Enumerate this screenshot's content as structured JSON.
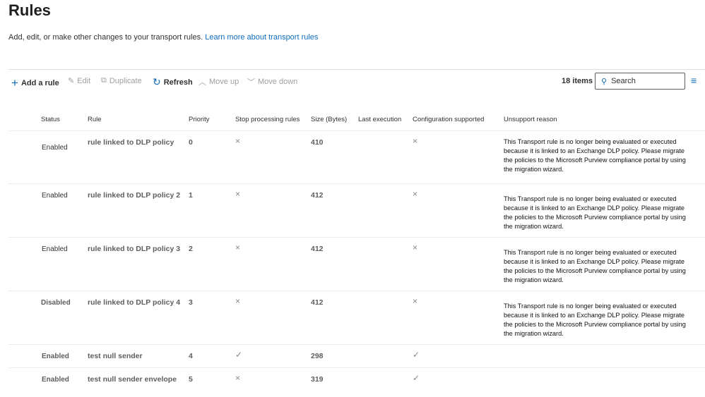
{
  "page": {
    "title": "Rules",
    "description": "Add, edit, or make other changes to your transport rules.",
    "learn_more": "Learn more about transport rules"
  },
  "toolbar": {
    "add": "Add a rule",
    "edit": "Edit",
    "duplicate": "Duplicate",
    "refresh": "Refresh",
    "move_up": "Move up",
    "move_down": "Move down",
    "count": "18 items",
    "search_placeholder": "Search"
  },
  "columns": [
    "Status",
    "Rule",
    "Priority",
    "Stop processing rules",
    "Size (Bytes)",
    "Last execution",
    "Configuration supported",
    "Unsupport reason"
  ],
  "rows": [
    {
      "status": "Enabled",
      "rule": "rule linked to DLP policy",
      "priority": "0",
      "stop": "×",
      "size": "410",
      "last": "",
      "config": "×",
      "reason": "This Transport rule is no longer being evaluated or executed because it is linked to an Exchange DLP policy. Please migrate the policies to the Microsoft Purview compliance portal by using the migration wizard."
    },
    {
      "status": "Enabled",
      "rule": "rule linked to DLP policy 2",
      "priority": "1",
      "stop": "×",
      "size": "412",
      "last": "",
      "config": "×",
      "reason": "This Transport rule is no longer being evaluated or executed because it is linked to an Exchange DLP policy. Please migrate the policies to the Microsoft Purview compliance portal by using the migration wizard."
    },
    {
      "status": "Enabled",
      "rule": "rule linked to DLP policy 3",
      "priority": "2",
      "stop": "×",
      "size": "412",
      "last": "",
      "config": "×",
      "reason": "This Transport rule is no longer being evaluated or executed because it is linked to an Exchange DLP policy. Please migrate the policies to the Microsoft Purview compliance portal by using the migration wizard."
    },
    {
      "status": "Disabled",
      "rule": "rule linked to DLP policy 4",
      "priority": "3",
      "stop": "×",
      "size": "412",
      "last": "",
      "config": "×",
      "reason": "This Transport rule is no longer being evaluated or executed because it is linked to an Exchange DLP policy. Please migrate the policies to the Microsoft Purview compliance portal by using the migration wizard."
    },
    {
      "status": "Enabled",
      "rule": "test null sender",
      "priority": "4",
      "stop": "✓",
      "size": "298",
      "last": "",
      "config": "✓",
      "reason": ""
    },
    {
      "status": "Enabled",
      "rule": "test null sender envelope",
      "priority": "5",
      "stop": "×",
      "size": "319",
      "last": "",
      "config": "✓",
      "reason": ""
    }
  ],
  "colors": {
    "accent": "#0f6cbd"
  }
}
